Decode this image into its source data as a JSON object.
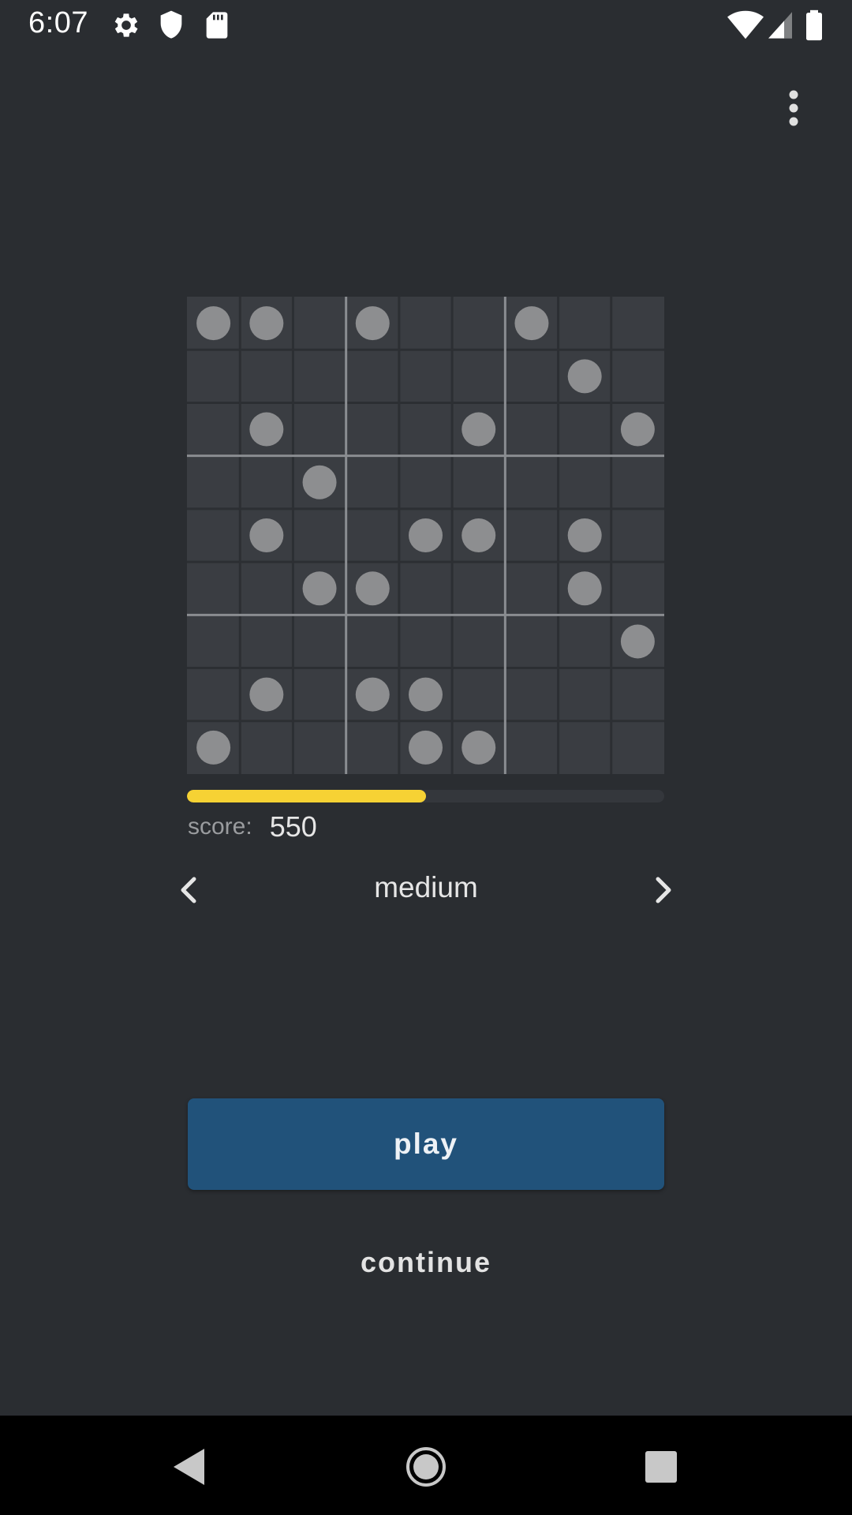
{
  "status_bar": {
    "time": "6:07",
    "left_icons": [
      "gear-icon",
      "shield-icon",
      "sd-card-icon"
    ],
    "right_icons": [
      "wifi-icon",
      "cell-signal-icon",
      "battery-icon"
    ]
  },
  "toolbar": {
    "menu_icon": "more-vertical-icon"
  },
  "board": {
    "size": 9,
    "filled_cells": [
      [
        0,
        0
      ],
      [
        0,
        1
      ],
      [
        0,
        3
      ],
      [
        0,
        6
      ],
      [
        1,
        7
      ],
      [
        2,
        1
      ],
      [
        2,
        5
      ],
      [
        2,
        8
      ],
      [
        3,
        2
      ],
      [
        4,
        1
      ],
      [
        4,
        4
      ],
      [
        4,
        5
      ],
      [
        4,
        7
      ],
      [
        5,
        2
      ],
      [
        5,
        3
      ],
      [
        5,
        7
      ],
      [
        6,
        8
      ],
      [
        7,
        1
      ],
      [
        7,
        3
      ],
      [
        7,
        4
      ],
      [
        8,
        0
      ],
      [
        8,
        4
      ],
      [
        8,
        5
      ]
    ]
  },
  "progress": {
    "fraction": 0.5
  },
  "score": {
    "label": "score:",
    "value": "550"
  },
  "difficulty": {
    "label": "medium",
    "prev_icon": "chevron-left-icon",
    "next_icon": "chevron-right-icon"
  },
  "buttons": {
    "play": "play",
    "continue": "continue"
  },
  "nav_bar": {
    "back_icon": "back-triangle-icon",
    "home_icon": "home-circle-icon",
    "recents_icon": "recents-square-icon"
  },
  "colors": {
    "background": "#2a2d31",
    "board": "#3a3d42",
    "dot": "#8d8e90",
    "progress": "#f6d234",
    "play_button": "#21527a"
  }
}
